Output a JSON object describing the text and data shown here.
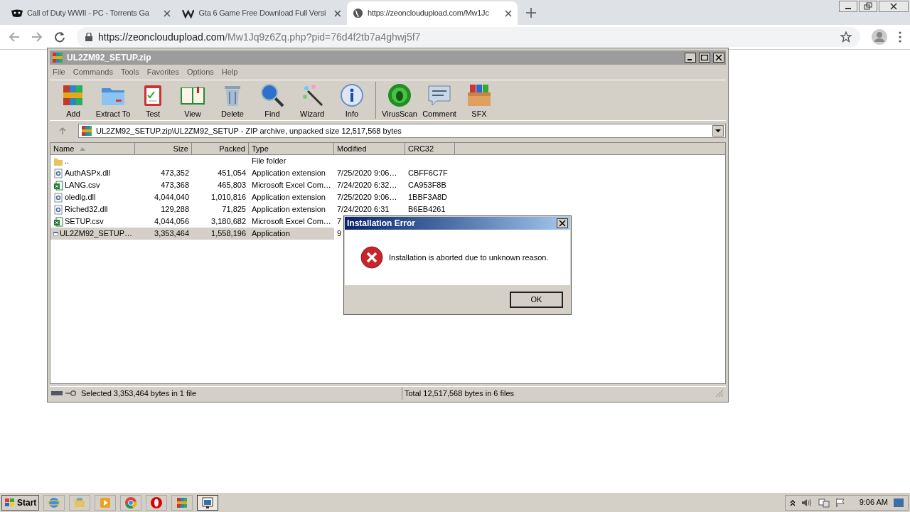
{
  "browser": {
    "tabs": [
      {
        "title": "Call of Duty WWII - PC - Torrents Ga",
        "kind": "mask",
        "selected": false
      },
      {
        "title": "Gta 6 Game Free Download Full Versi",
        "kind": "w",
        "selected": false
      },
      {
        "title": "https://zeoncloudupload.com/Mw1Jc",
        "kind": "globe",
        "selected": true
      }
    ],
    "url": {
      "host": "https://zeoncloudupload.com",
      "path": "/Mw1Jq9z6Zq.php?pid=76d4f2tb7a4ghwj5f7"
    }
  },
  "winrar": {
    "title": "UL2ZM92_SETUP.zip",
    "menu": [
      "File",
      "Commands",
      "Tools",
      "Favorites",
      "Options",
      "Help"
    ],
    "toolbar": [
      {
        "label": "Add",
        "kind": "add"
      },
      {
        "label": "Extract To",
        "kind": "extract"
      },
      {
        "label": "Test",
        "kind": "test"
      },
      {
        "label": "View",
        "kind": "view"
      },
      {
        "label": "Delete",
        "kind": "delete"
      },
      {
        "label": "Find",
        "kind": "find"
      },
      {
        "label": "Wizard",
        "kind": "wizard"
      },
      {
        "label": "Info",
        "kind": "info"
      },
      {
        "label": "VirusScan",
        "kind": "virus"
      },
      {
        "label": "Comment",
        "kind": "comment"
      },
      {
        "label": "SFX",
        "kind": "sfx"
      }
    ],
    "path": "UL2ZM92_SETUP.zip\\UL2ZM92_SETUP - ZIP archive, unpacked size 12,517,568 bytes",
    "columns": [
      "Name",
      "Size",
      "Packed",
      "Type",
      "Modified",
      "CRC32"
    ],
    "rows": [
      {
        "kind": "folder",
        "name": "..",
        "size": "",
        "packed": "",
        "type": "File folder",
        "modified": "",
        "crc": "",
        "selected": false
      },
      {
        "kind": "dll",
        "name": "AuthASPx.dll",
        "size": "473,352",
        "packed": "451,054",
        "type": "Application extension",
        "modified": "7/25/2020 9:06…",
        "crc": "CBFF6C7F",
        "selected": false
      },
      {
        "kind": "csv",
        "name": "LANG.csv",
        "size": "473,368",
        "packed": "465,803",
        "type": "Microsoft Excel Com…",
        "modified": "7/24/2020 6:32…",
        "crc": "CA953F8B",
        "selected": false
      },
      {
        "kind": "dll",
        "name": "oledlg.dll",
        "size": "4,044,040",
        "packed": "1,010,816",
        "type": "Application extension",
        "modified": "7/25/2020 9:06…",
        "crc": "1BBF3A8D",
        "selected": false
      },
      {
        "kind": "dll",
        "name": "Riched32.dll",
        "size": "129,288",
        "packed": "71,825",
        "type": "Application extension",
        "modified": "7/24/2020 6:31",
        "crc": "B6EB4261",
        "selected": false
      },
      {
        "kind": "csv",
        "name": "SETUP.csv",
        "size": "4,044,056",
        "packed": "3,180,682",
        "type": "Microsoft Excel Com…",
        "modified": "7",
        "crc": "",
        "selected": false
      },
      {
        "kind": "exe",
        "name": "UL2ZM92_SETUP…",
        "size": "3,353,464",
        "packed": "1,558,196",
        "type": "Application",
        "modified": "9",
        "crc": "",
        "selected": true
      }
    ],
    "status": {
      "left": "Selected 3,353,464 bytes in 1 file",
      "right": "Total 12,517,568 bytes in 6 files"
    }
  },
  "dialog": {
    "title": "Installation Error",
    "message": "Installation is aborted due to unknown reason.",
    "button": "OK"
  },
  "taskbar": {
    "start": "Start",
    "apps": [
      {
        "kind": "ie",
        "selected": false
      },
      {
        "kind": "explorer",
        "selected": false
      },
      {
        "kind": "media",
        "selected": false
      },
      {
        "kind": "chrome",
        "selected": false
      },
      {
        "kind": "opera",
        "selected": false
      },
      {
        "kind": "winrar",
        "selected": false
      },
      {
        "kind": "window",
        "selected": true
      }
    ],
    "clock": "9:06 AM"
  }
}
